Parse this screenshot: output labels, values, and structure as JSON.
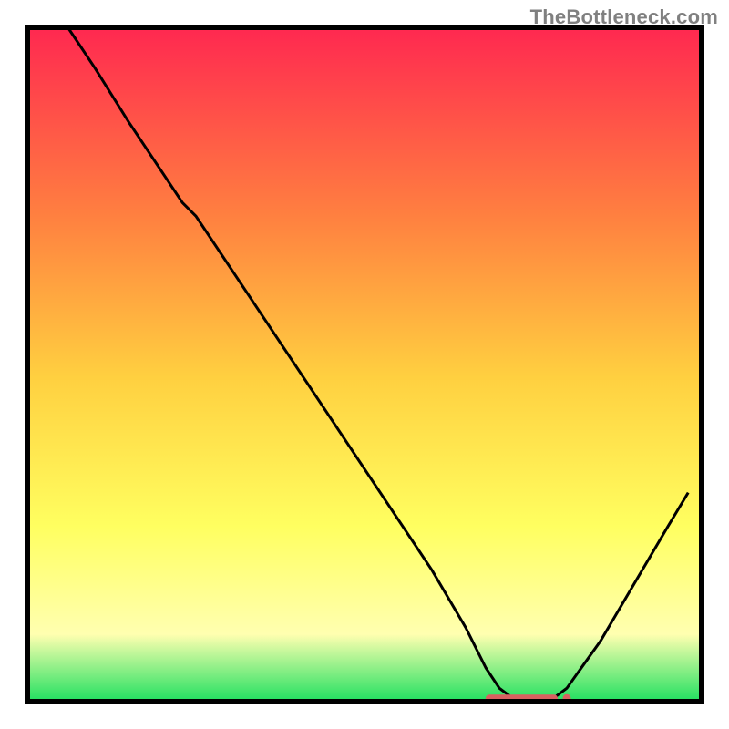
{
  "watermark": "TheBottleneck.com",
  "chart_data": {
    "type": "line",
    "title": "",
    "xlabel": "",
    "ylabel": "",
    "xlim": [
      0,
      100
    ],
    "ylim": [
      0,
      100
    ],
    "background_gradient": {
      "top": "#ff2850",
      "mid_upper": "#ff8040",
      "mid": "#ffd040",
      "mid_lower": "#ffff60",
      "band": "#ffffb0",
      "bottom": "#20e060"
    },
    "series": [
      {
        "name": "bottleneck-curve",
        "color": "#000000",
        "x": [
          6.0,
          10.0,
          15.0,
          20.0,
          23.0,
          25.0,
          30.0,
          35.0,
          40.0,
          45.0,
          50.0,
          55.0,
          60.0,
          65.0,
          68.0,
          70.0,
          72.0,
          75.0,
          78.0,
          80.0,
          85.0,
          90.0,
          95.0,
          98.0
        ],
        "y": [
          100.0,
          94.0,
          86.0,
          78.5,
          74.0,
          72.0,
          64.5,
          57.0,
          49.5,
          42.0,
          34.5,
          27.0,
          19.5,
          11.0,
          5.0,
          2.0,
          0.5,
          0.0,
          0.5,
          2.0,
          9.0,
          17.5,
          26.0,
          31.0
        ]
      }
    ],
    "marker_band": {
      "name": "optimal-range",
      "color": "#d86060",
      "x_start": 68.5,
      "x_end": 80.0,
      "y": 0.5
    },
    "frame": {
      "color": "#000000",
      "width": 6
    }
  }
}
